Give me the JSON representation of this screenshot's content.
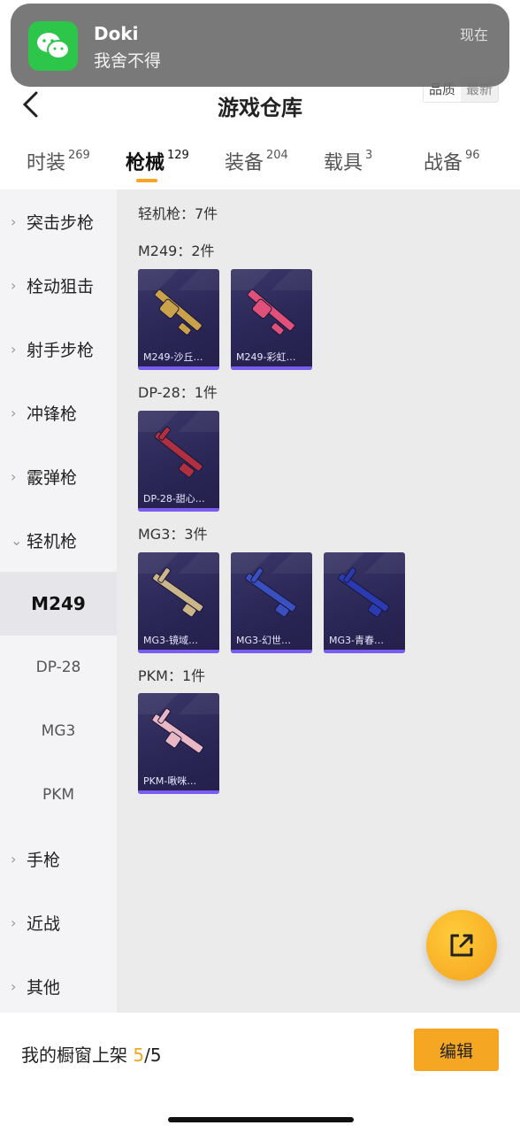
{
  "notification": {
    "app_icon": "wechat-icon",
    "title": "Doki",
    "body": "我舍不得",
    "time": "现在"
  },
  "header": {
    "title": "游戏仓库",
    "sort_options": [
      "品质",
      "最新"
    ]
  },
  "tabs": [
    {
      "label": "时装",
      "count": "269"
    },
    {
      "label": "枪械",
      "count": "129",
      "active": true
    },
    {
      "label": "装备",
      "count": "204"
    },
    {
      "label": "载具",
      "count": "3"
    },
    {
      "label": "战备",
      "count": "96"
    }
  ],
  "sidebar": {
    "categories": [
      {
        "label": "突击步枪"
      },
      {
        "label": "栓动狙击"
      },
      {
        "label": "射手步枪"
      },
      {
        "label": "冲锋枪"
      },
      {
        "label": "霰弹枪"
      },
      {
        "label": "轻机枪",
        "expanded": true
      }
    ],
    "sub_items": [
      {
        "label": "M249",
        "active": true
      },
      {
        "label": "DP-28"
      },
      {
        "label": "MG3"
      },
      {
        "label": "PKM"
      }
    ],
    "more_categories": [
      {
        "label": "手枪"
      },
      {
        "label": "近战"
      },
      {
        "label": "其他"
      }
    ]
  },
  "main": {
    "category_summary": "轻机枪：7件",
    "groups": [
      {
        "title": "M249：2件",
        "items": [
          {
            "caption": "M249-沙丘…",
            "color": "#c9a24a"
          },
          {
            "caption": "M249-彩虹…",
            "color": "#e0507a"
          }
        ]
      },
      {
        "title": "DP-28：1件",
        "items": [
          {
            "caption": "DP-28-甜心…",
            "color": "#b03040"
          }
        ]
      },
      {
        "title": "MG3：3件",
        "items": [
          {
            "caption": "MG3-镜域…",
            "color": "#cdb58a"
          },
          {
            "caption": "MG3-幻世…",
            "color": "#3a4fc0"
          },
          {
            "caption": "MG3-青春…",
            "color": "#2a3ab0"
          }
        ]
      },
      {
        "title": "PKM：1件",
        "items": [
          {
            "caption": "PKM-啾咪…",
            "color": "#e8b8c4"
          }
        ]
      }
    ]
  },
  "fab": {
    "icon": "share-icon"
  },
  "bottom": {
    "shelf_label": "我的橱窗上架",
    "shelf_current": "5",
    "shelf_total": "/5",
    "edit_label": "编辑"
  },
  "colors": {
    "accent": "#f5a623",
    "card_bg": "#2a2656",
    "card_bar": "#7a5cf0"
  }
}
